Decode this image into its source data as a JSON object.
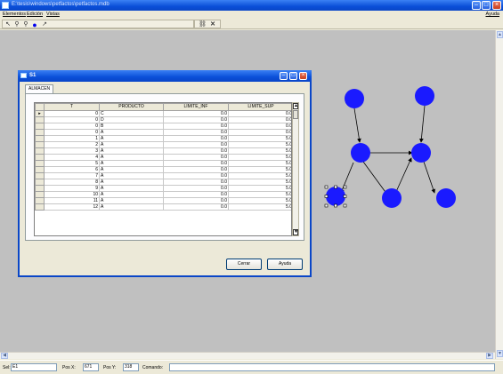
{
  "window": {
    "title": "E:\\tesis\\windows\\petfactos\\petfactos.mdb"
  },
  "menu": [
    "Elementos",
    "Edición",
    "Vistas"
  ],
  "menu_help": "Ayuda",
  "toolbar_icons": [
    "select-icon",
    "zoom-in-icon",
    "zoom-out-icon",
    "circle-place-icon",
    "arrow-place-icon",
    "link-icon",
    "close-icon"
  ],
  "dialog": {
    "title": "S1",
    "tab": "ALMACEN",
    "columns": [
      "T",
      "PRODUCTO",
      "LIMITE_INF",
      "LIMITE_SUP"
    ],
    "rows": [
      [
        "0",
        "C",
        "0.0",
        "0.0"
      ],
      [
        "0",
        "D",
        "0.0",
        "0.0"
      ],
      [
        "0",
        "B",
        "0.0",
        "0.0"
      ],
      [
        "0",
        "A",
        "0.0",
        "0.0"
      ],
      [
        "1",
        "A",
        "0.0",
        "5.0"
      ],
      [
        "2",
        "A",
        "0.0",
        "5.0"
      ],
      [
        "3",
        "A",
        "0.0",
        "5.0"
      ],
      [
        "4",
        "A",
        "0.0",
        "5.0"
      ],
      [
        "5",
        "A",
        "0.0",
        "5.0"
      ],
      [
        "6",
        "A",
        "0.0",
        "5.0"
      ],
      [
        "7",
        "A",
        "0.0",
        "5.0"
      ],
      [
        "8",
        "A",
        "0.0",
        "5.0"
      ],
      [
        "9",
        "A",
        "0.0",
        "5.0"
      ],
      [
        "10",
        "A",
        "0.0",
        "5.0"
      ],
      [
        "11",
        "A",
        "0.0",
        "5.0"
      ],
      [
        "12",
        "A",
        "0.0",
        "5.0"
      ]
    ],
    "cancel_label": "Cerrar",
    "help_label": "Ayuda"
  },
  "status": {
    "sel_label": "Sel:",
    "sel_value": "E1",
    "posx_label": "Pos X:",
    "posx_value": "671",
    "posy_label": "Pos Y:",
    "posy_value": "318",
    "command_label": "Comando:",
    "command_value": ""
  },
  "colors": {
    "node": "#1a1aff",
    "workspace": "#c0c0c0",
    "titlebar": "#0a4fd8"
  }
}
